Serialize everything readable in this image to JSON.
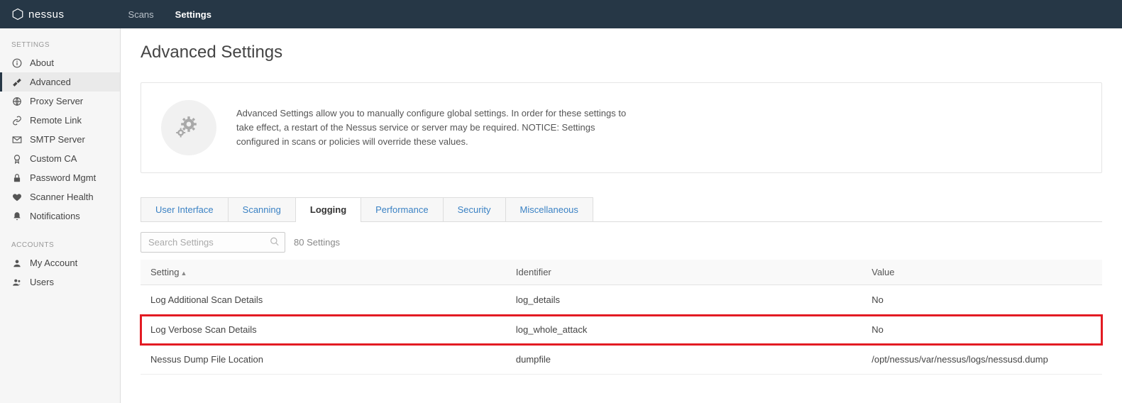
{
  "brand": "nessus",
  "topNav": {
    "scans": "Scans",
    "settings": "Settings"
  },
  "sidebar": {
    "sectionSettings": "SETTINGS",
    "sectionAccounts": "ACCOUNTS",
    "items": {
      "about": "About",
      "advanced": "Advanced",
      "proxy": "Proxy Server",
      "remote": "Remote Link",
      "smtp": "SMTP Server",
      "customca": "Custom CA",
      "password": "Password Mgmt",
      "health": "Scanner Health",
      "notifications": "Notifications",
      "myaccount": "My Account",
      "users": "Users"
    }
  },
  "page": {
    "title": "Advanced Settings",
    "bannerText": "Advanced Settings allow you to manually configure global settings. In order for these settings to take effect, a restart of the Nessus service or server may be required. NOTICE: Settings configured in scans or policies will override these values."
  },
  "tabs": {
    "ui": "User Interface",
    "scanning": "Scanning",
    "logging": "Logging",
    "performance": "Performance",
    "security": "Security",
    "misc": "Miscellaneous"
  },
  "search": {
    "placeholder": "Search Settings",
    "count": "80 Settings"
  },
  "table": {
    "hSetting": "Setting",
    "hIdentifier": "Identifier",
    "hValue": "Value",
    "rows": [
      {
        "setting": "Log Additional Scan Details",
        "id": "log_details",
        "value": "No"
      },
      {
        "setting": "Log Verbose Scan Details",
        "id": "log_whole_attack",
        "value": "No"
      },
      {
        "setting": "Nessus Dump File Location",
        "id": "dumpfile",
        "value": "/opt/nessus/var/nessus/logs/nessusd.dump"
      }
    ]
  }
}
